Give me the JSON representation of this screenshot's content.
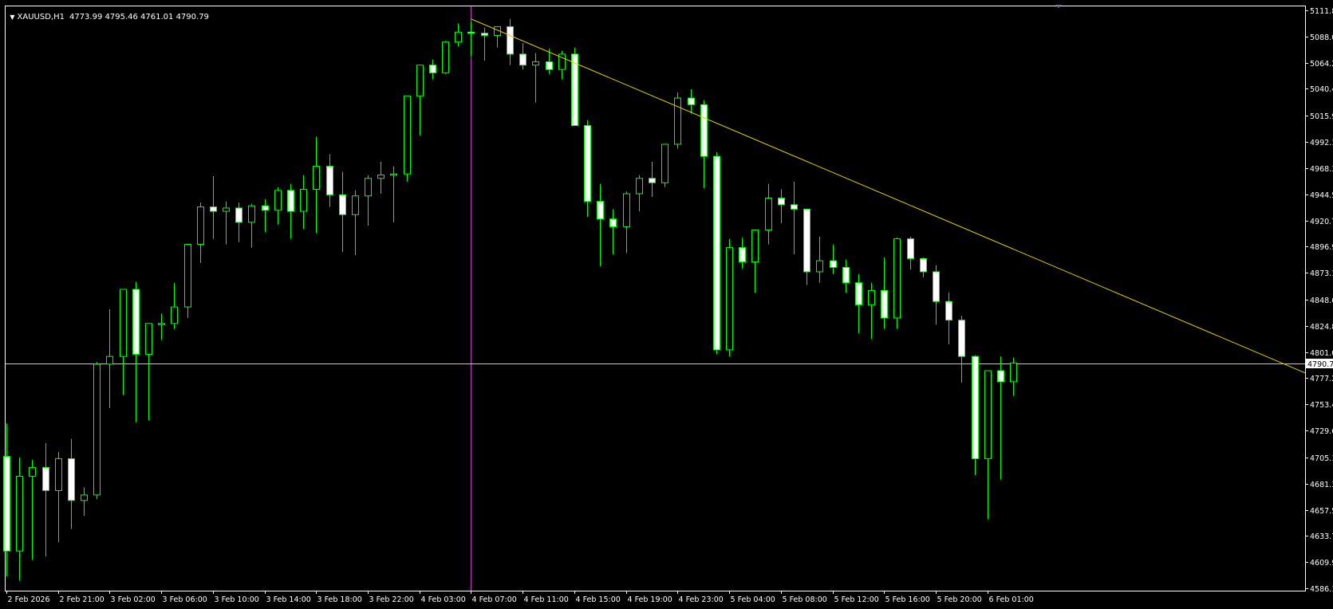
{
  "header": {
    "symbol": "XAUUSD,H1",
    "ohlc": "4773.99 4795.46 4761.01 4790.79"
  },
  "chart_data": {
    "type": "candlestick",
    "symbol": "XAUUSD",
    "timeframe": "H1",
    "bullish_color": "#000000",
    "bearish_color": "#FFFFFF",
    "wick_color": "#00FF00",
    "ylim": [
      4586.1,
      5120.0
    ],
    "price_ticks": [
      "5111.80",
      "5088.00",
      "5064.20",
      "5040.40",
      "5015.90",
      "4992.10",
      "4968.30",
      "4944.50",
      "4920.70",
      "4896.90",
      "4873.10",
      "4848.60",
      "4824.80",
      "4801.00",
      "4777.20",
      "4753.40",
      "4729.60",
      "4705.10",
      "4681.30",
      "4657.50",
      "4633.70",
      "4609.90",
      "4586.10"
    ],
    "time_labels": [
      {
        "i": 0,
        "label": "2 Feb 2026"
      },
      {
        "i": 4,
        "label": "2 Feb 21:00"
      },
      {
        "i": 8,
        "label": "3 Feb 02:00"
      },
      {
        "i": 12,
        "label": "3 Feb 06:00"
      },
      {
        "i": 16,
        "label": "3 Feb 10:00"
      },
      {
        "i": 20,
        "label": "3 Feb 14:00"
      },
      {
        "i": 24,
        "label": "3 Feb 18:00"
      },
      {
        "i": 28,
        "label": "3 Feb 22:00"
      },
      {
        "i": 32,
        "label": "4 Feb 03:00"
      },
      {
        "i": 36,
        "label": "4 Feb 07:00"
      },
      {
        "i": 40,
        "label": "4 Feb 11:00"
      },
      {
        "i": 44,
        "label": "4 Feb 15:00"
      },
      {
        "i": 48,
        "label": "4 Feb 19:00"
      },
      {
        "i": 52,
        "label": "4 Feb 23:00"
      },
      {
        "i": 56,
        "label": "5 Feb 04:00"
      },
      {
        "i": 60,
        "label": "5 Feb 08:00"
      },
      {
        "i": 64,
        "label": "5 Feb 12:00"
      },
      {
        "i": 68,
        "label": "5 Feb 16:00"
      },
      {
        "i": 72,
        "label": "5 Feb 20:00"
      },
      {
        "i": 76,
        "label": "6 Feb 01:00"
      }
    ],
    "candles": [
      [
        4706,
        4736,
        4597,
        4620
      ],
      [
        4620,
        4705,
        4593,
        4688
      ],
      [
        4688,
        4703,
        4612,
        4696
      ],
      [
        4696,
        4718,
        4615,
        4675
      ],
      [
        4675,
        4710,
        4628,
        4704
      ],
      [
        4704,
        4722,
        4640,
        4666
      ],
      [
        4666,
        4678,
        4652,
        4671
      ],
      [
        4671,
        4792,
        4667,
        4790
      ],
      [
        4790,
        4840,
        4750,
        4797
      ],
      [
        4797,
        4854,
        4762,
        4858
      ],
      [
        4858,
        4865,
        4737,
        4799
      ],
      [
        4799,
        4824,
        4739,
        4827
      ],
      [
        4827,
        4836,
        4812,
        4827
      ],
      [
        4827,
        4864,
        4822,
        4842
      ],
      [
        4842,
        4897,
        4832,
        4899
      ],
      [
        4899,
        4937,
        4882,
        4933
      ],
      [
        4933,
        4961,
        4904,
        4929
      ],
      [
        4929,
        4938,
        4899,
        4932
      ],
      [
        4932,
        4937,
        4901,
        4919
      ],
      [
        4919,
        4936,
        4896,
        4934
      ],
      [
        4934,
        4940,
        4910,
        4930
      ],
      [
        4930,
        4951,
        4917,
        4948
      ],
      [
        4948,
        4954,
        4904,
        4929
      ],
      [
        4929,
        4962,
        4913,
        4949
      ],
      [
        4949,
        4997,
        4909,
        4970
      ],
      [
        4970,
        4981,
        4933,
        4944
      ],
      [
        4944,
        4965,
        4892,
        4926
      ],
      [
        4926,
        4948,
        4889,
        4943
      ],
      [
        4943,
        4962,
        4916,
        4959
      ],
      [
        4959,
        4974,
        4945,
        4962
      ],
      [
        4962,
        4970,
        4919,
        4963
      ],
      [
        4963,
        5034,
        4956,
        5034
      ],
      [
        5034,
        5061,
        4998,
        5062
      ],
      [
        5062,
        5067,
        5049,
        5055
      ],
      [
        5055,
        5084,
        5054,
        5083
      ],
      [
        5083,
        5100,
        5079,
        5092
      ],
      [
        5092,
        5102,
        5070,
        5091
      ],
      [
        5091,
        5096,
        5066,
        5089
      ],
      [
        5089,
        5097,
        5078,
        5097
      ],
      [
        5097,
        5104,
        5062,
        5072
      ],
      [
        5072,
        5082,
        5058,
        5062
      ],
      [
        5062,
        5073,
        5028,
        5065
      ],
      [
        5065,
        5077,
        5054,
        5058
      ],
      [
        5058,
        5075,
        5049,
        5072
      ],
      [
        5072,
        5078,
        5054,
        5007
      ],
      [
        5007,
        5012,
        4924,
        4938
      ],
      [
        4938,
        4954,
        4879,
        4922
      ],
      [
        4922,
        4931,
        4890,
        4915
      ],
      [
        4915,
        4947,
        4891,
        4945
      ],
      [
        4945,
        4962,
        4929,
        4959
      ],
      [
        4959,
        4974,
        4942,
        4955
      ],
      [
        4955,
        4990,
        4951,
        4990
      ],
      [
        4990,
        5037,
        4986,
        5032
      ],
      [
        5032,
        5040,
        5018,
        5026
      ],
      [
        5026,
        5030,
        4950,
        4979
      ],
      [
        4979,
        4983,
        4799,
        4803
      ],
      [
        4803,
        4904,
        4797,
        4896
      ],
      [
        4896,
        4905,
        4877,
        4883
      ],
      [
        4883,
        4910,
        4855,
        4912
      ],
      [
        4912,
        4954,
        4899,
        4941
      ],
      [
        4941,
        4949,
        4918,
        4935
      ],
      [
        4935,
        4956,
        4890,
        4931
      ],
      [
        4931,
        4931,
        4862,
        4874
      ],
      [
        4874,
        4906,
        4864,
        4884
      ],
      [
        4884,
        4899,
        4872,
        4878
      ],
      [
        4878,
        4885,
        4855,
        4864
      ],
      [
        4864,
        4872,
        4818,
        4844
      ],
      [
        4844,
        4864,
        4813,
        4857
      ],
      [
        4857,
        4887,
        4822,
        4832
      ],
      [
        4832,
        4905,
        4822,
        4904
      ],
      [
        4904,
        4906,
        4876,
        4886
      ],
      [
        4886,
        4887,
        4869,
        4874
      ],
      [
        4874,
        4880,
        4826,
        4847
      ],
      [
        4847,
        4855,
        4808,
        4830
      ],
      [
        4830,
        4834,
        4773,
        4797
      ],
      [
        4797,
        4798,
        4689,
        4704
      ],
      [
        4704,
        4781,
        4649,
        4784
      ],
      [
        4784,
        4797,
        4685,
        4774
      ],
      [
        4774,
        4796,
        4761,
        4791
      ]
    ],
    "trendline": {
      "color": "#E6D000",
      "from": {
        "i": 36,
        "price": 5104.0
      },
      "to_price_at_edge": 4782.0
    },
    "vlines": {
      "color": "#C43CC4",
      "indices": [
        36,
        105
      ]
    },
    "current_price": {
      "value": "4790.79",
      "color": "#C8C8C8"
    }
  }
}
